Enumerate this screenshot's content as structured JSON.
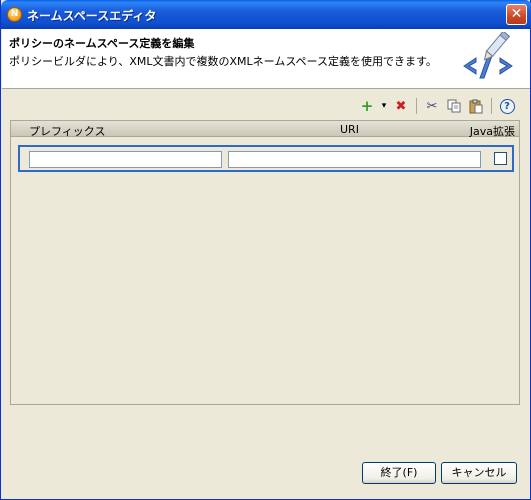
{
  "window": {
    "title": "ネームスペースエディタ",
    "close_glyph": "✕"
  },
  "banner": {
    "title": "ポリシーのネームスペース定義を編集",
    "description": "ポリシービルダにより、XML文書内で複数のXMLネームスペース定義を使用できます。",
    "logo_icon": "xml-tag-pen-icon"
  },
  "toolbar": {
    "add_icon": "+",
    "dropdown_icon": "▾",
    "delete_icon": "✖",
    "cut_icon": "✂",
    "copy_icon": "⧉",
    "paste_icon": "📋",
    "help_icon": "?"
  },
  "table": {
    "columns": [
      "プレフィックス",
      "URI",
      "Java拡張"
    ],
    "rows": [
      {
        "prefix": "",
        "uri": "",
        "java_extension": false
      }
    ]
  },
  "buttons": {
    "ok": "終了(F)",
    "cancel": "キャンセル"
  },
  "colors": {
    "accent": "#316ac5",
    "titlebar": "#0f4fd1",
    "delete": "#d11d1d",
    "add": "#3a9b2a"
  }
}
